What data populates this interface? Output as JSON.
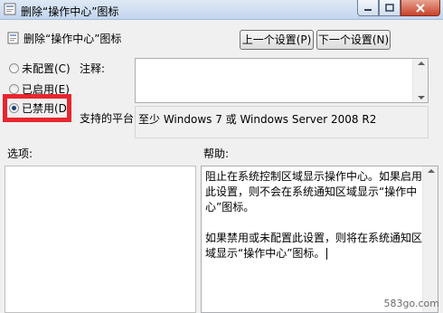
{
  "window": {
    "title": "删除“操作中心”图标"
  },
  "header": {
    "title": "删除“操作中心”图标",
    "prev_button": "上一个设置(P)",
    "next_button": "下一个设置(N)"
  },
  "options": {
    "not_configured": "未配置(C)",
    "enabled": "已启用(E)",
    "disabled": "已禁用(D)",
    "selected": "disabled"
  },
  "comment": {
    "label": "注释:",
    "value": ""
  },
  "platform": {
    "label": "支持的平台:",
    "value": "至少 Windows 7 或 Windows Server 2008 R2"
  },
  "options_panel": {
    "label": "选项:"
  },
  "help": {
    "label": "帮助:",
    "paragraph1": "阻止在系统控制区域显示操作中心。如果启用此设置，则不会在系统通知区域显示“操作中心”图标。",
    "paragraph2": "如果禁用或未配置此设置，则将在系统通知区域显示“操作中心”图标。"
  },
  "watermark": "583go.com"
}
